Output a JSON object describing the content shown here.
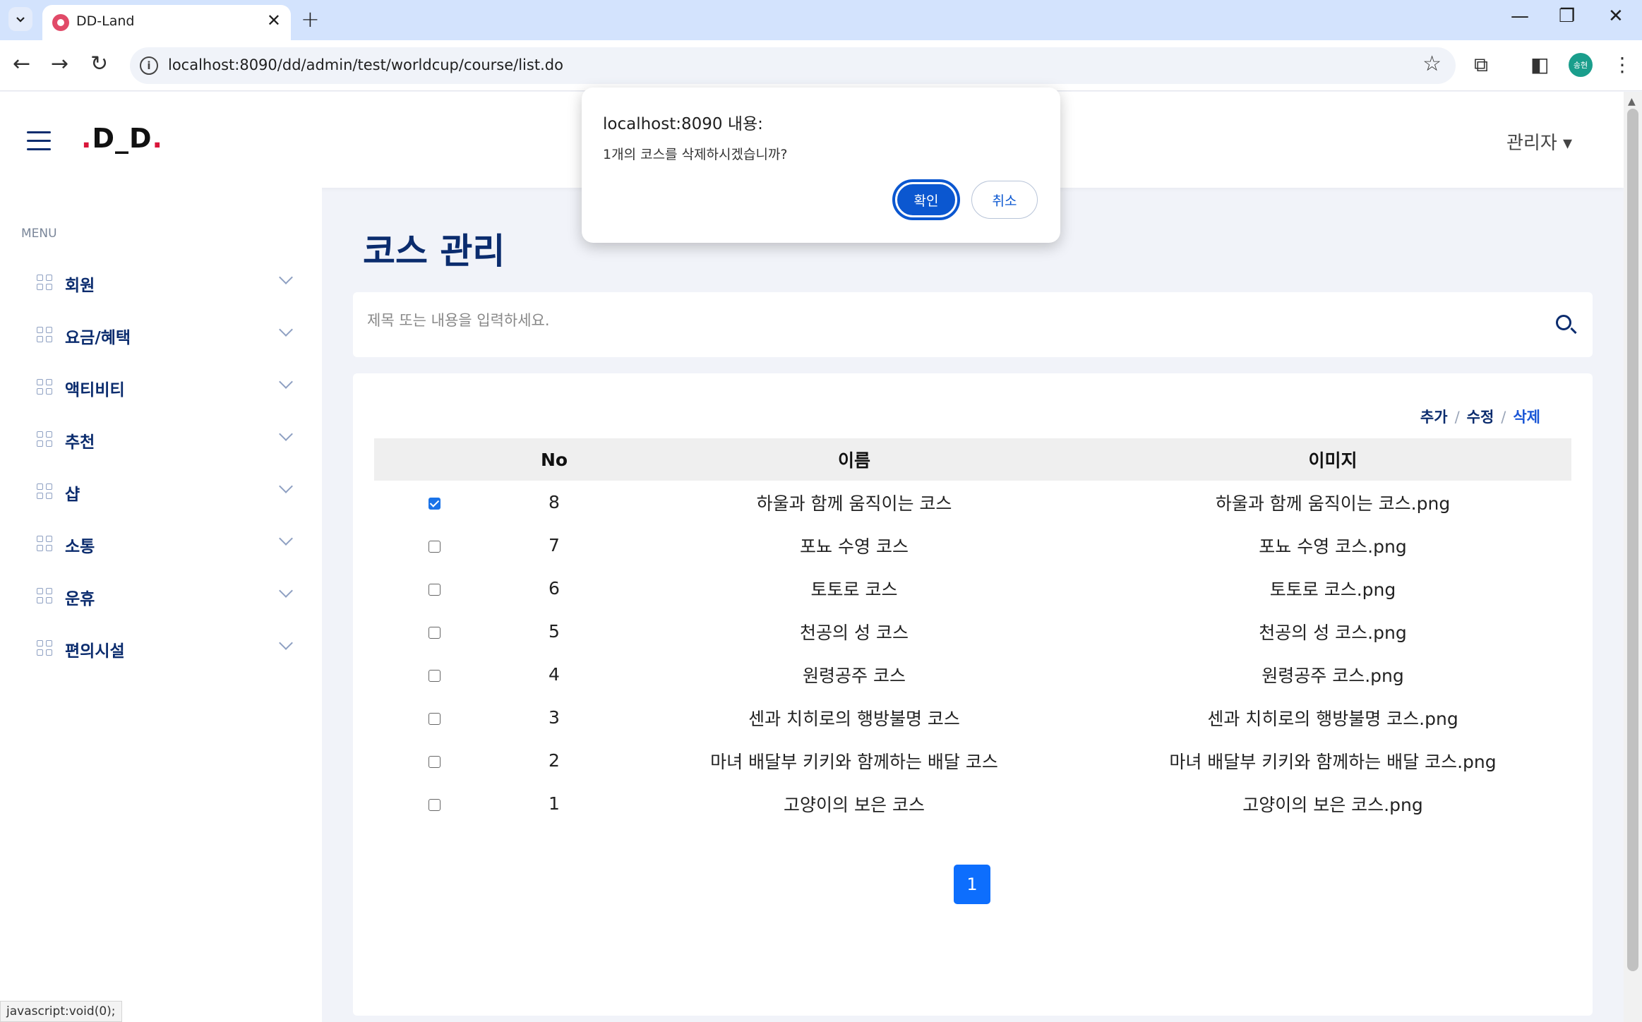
{
  "browser": {
    "tab_title": "DD-Land",
    "tab_close": "✕",
    "new_tab": "+",
    "url": "localhost:8090/dd/admin/test/worldcup/course/list.do",
    "profile_label": "송현",
    "window_controls": {
      "minimize": "—",
      "restore": "❐",
      "close": "✕"
    },
    "status_text": "javascript:void(0);"
  },
  "header": {
    "logo_prefix": ".",
    "logo_text": "D_D",
    "logo_suffix": ".",
    "logo_dot_color": "#d9163a",
    "admin_label": "관리자 ▾"
  },
  "sidebar": {
    "heading": "MENU",
    "items": [
      {
        "label": "회원"
      },
      {
        "label": "요금/혜택"
      },
      {
        "label": "액티비티"
      },
      {
        "label": "추천"
      },
      {
        "label": "샵"
      },
      {
        "label": "소통"
      },
      {
        "label": "운휴"
      },
      {
        "label": "편의시설"
      }
    ]
  },
  "main": {
    "title": "코스 관리",
    "search_placeholder": "제목 또는 내용을 입력하세요.",
    "actions": {
      "add": "추가",
      "edit": "수정",
      "delete": "삭제",
      "separator": "/"
    },
    "table": {
      "headers": [
        "",
        "No",
        "이름",
        "이미지"
      ],
      "rows": [
        {
          "checked": true,
          "no": "8",
          "name": "하울과 함께 움직이는 코스",
          "image": "하울과 함께 움직이는 코스.png"
        },
        {
          "checked": false,
          "no": "7",
          "name": "포뇨 수영 코스",
          "image": "포뇨 수영 코스.png"
        },
        {
          "checked": false,
          "no": "6",
          "name": "토토로 코스",
          "image": "토토로 코스.png"
        },
        {
          "checked": false,
          "no": "5",
          "name": "천공의 성 코스",
          "image": "천공의 성 코스.png"
        },
        {
          "checked": false,
          "no": "4",
          "name": "원령공주 코스",
          "image": "원령공주 코스.png"
        },
        {
          "checked": false,
          "no": "3",
          "name": "센과 치히로의 행방불명 코스",
          "image": "센과 치히로의 행방불명 코스.png"
        },
        {
          "checked": false,
          "no": "2",
          "name": "마녀 배달부 키키와 함께하는 배달 코스",
          "image": "마녀 배달부 키키와 함께하는 배달 코스.png"
        },
        {
          "checked": false,
          "no": "1",
          "name": "고양이의 보은 코스",
          "image": "고양이의 보은 코스.png"
        }
      ]
    },
    "pagination": {
      "current_page": "1"
    }
  },
  "dialog": {
    "title": "localhost:8090 내용:",
    "message": "1개의 코스를 삭제하시겠습니까?",
    "ok_label": "확인",
    "cancel_label": "취소"
  },
  "colors": {
    "primary_navy": "#0b2c6e",
    "accent_blue": "#0d6efd",
    "tabstrip": "#d3e3fd"
  }
}
